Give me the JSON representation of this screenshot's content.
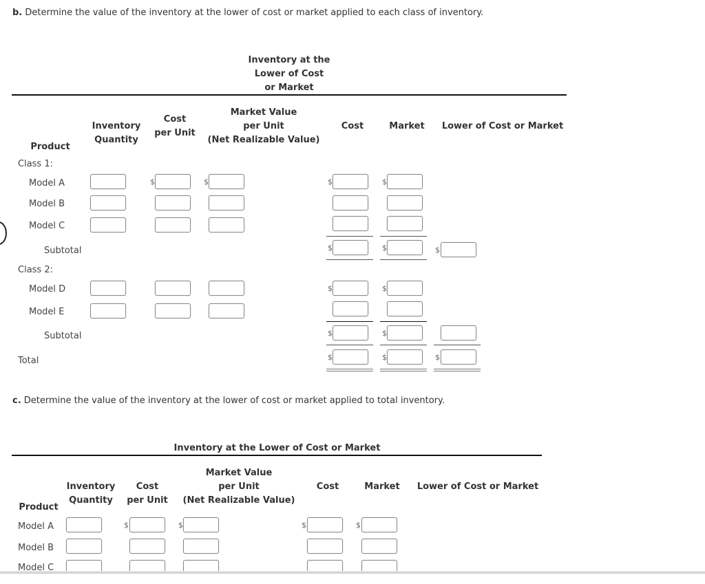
{
  "part_b": {
    "letter": "b.",
    "instruction": "Determine the value of the inventory at the lower of cost or market applied to each class of inventory.",
    "group_header": [
      "Inventory at the",
      "Lower of Cost",
      "or Market"
    ],
    "columns": {
      "product": "Product",
      "inventory_quantity": [
        "Inventory",
        "Quantity"
      ],
      "cost_per_unit": [
        "Cost",
        "per Unit"
      ],
      "market_value": [
        "Market Value",
        "per Unit",
        "(Net Realizable Value)"
      ],
      "cost": "Cost",
      "market": "Market",
      "lcm": "Lower of Cost or Market"
    },
    "class1_label": "Class 1:",
    "class2_label": "Class 2:",
    "rows": [
      "Model A",
      "Model B",
      "Model C",
      "Model D",
      "Model E"
    ],
    "subtotal_label": "Subtotal",
    "total_label": "Total",
    "currency_symbol": "$"
  },
  "part_c": {
    "letter": "c.",
    "instruction": "Determine the value of the inventory at the lower of cost or market applied to total inventory.",
    "group_header": "Inventory at the Lower of Cost or Market",
    "columns": {
      "product": "Product",
      "inventory_quantity": [
        "Inventory",
        "Quantity"
      ],
      "cost_per_unit": [
        "Cost",
        "per Unit"
      ],
      "market_value": [
        "Market Value",
        "per Unit",
        "(Net Realizable Value)"
      ],
      "cost": "Cost",
      "market": "Market",
      "lcm": "Lower of Cost or Market"
    },
    "rows": [
      "Model A",
      "Model B",
      "Model C"
    ],
    "currency_symbol": "$"
  }
}
